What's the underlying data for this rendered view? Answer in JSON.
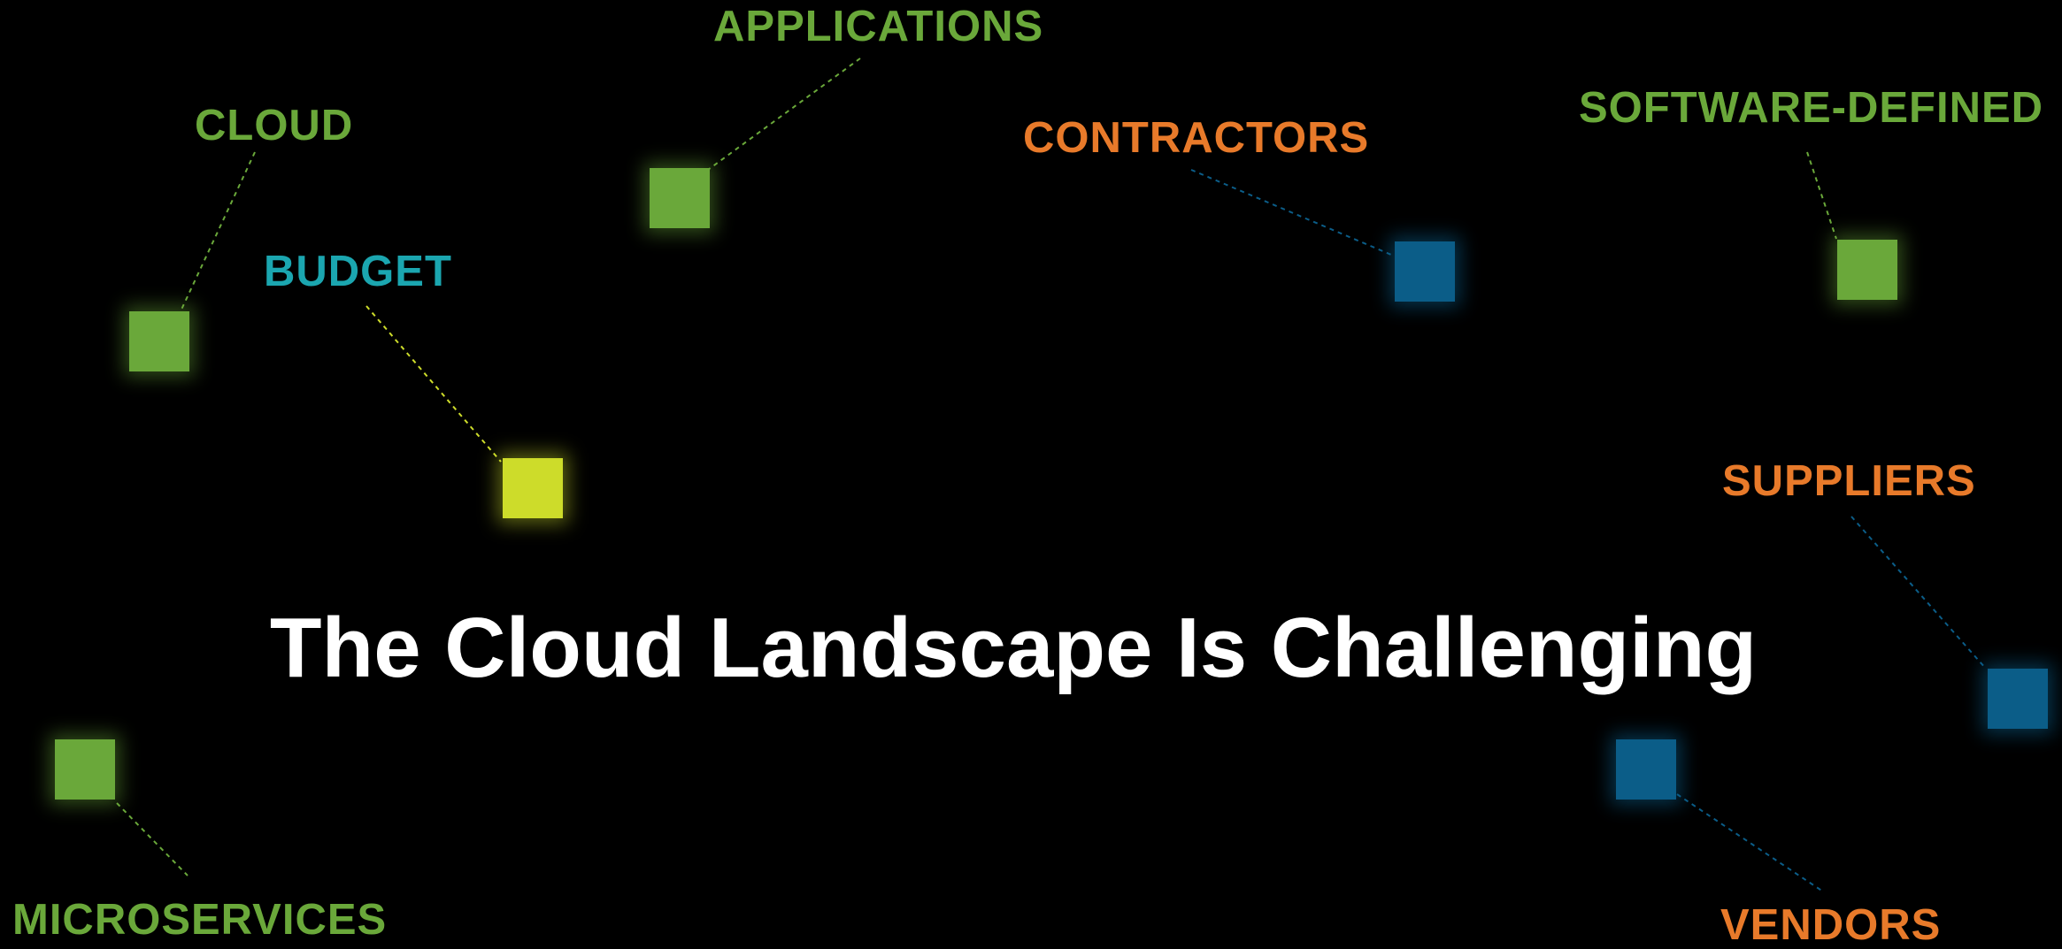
{
  "colors": {
    "background": "#000000",
    "green": "#6aa83a",
    "orange": "#e87a2a",
    "teal": "#1ba6b0",
    "yellow": "#cddc2a",
    "blue": "#0b5d88",
    "title": "#ffffff"
  },
  "title": "The Cloud Landscape Is Challenging",
  "items": {
    "applications": {
      "label": "APPLICATIONS",
      "category": "green"
    },
    "cloud": {
      "label": "CLOUD",
      "category": "green"
    },
    "budget": {
      "label": "BUDGET",
      "category": "yellow"
    },
    "contractors": {
      "label": "CONTRACTORS",
      "category": "blue"
    },
    "software_defined": {
      "label": "SOFTWARE-DEFINED",
      "category": "green"
    },
    "suppliers": {
      "label": "SUPPLIERS",
      "category": "blue"
    },
    "microservices": {
      "label": "MICROSERVICES",
      "category": "green"
    },
    "vendors": {
      "label": "VENDORS",
      "category": "blue"
    }
  }
}
